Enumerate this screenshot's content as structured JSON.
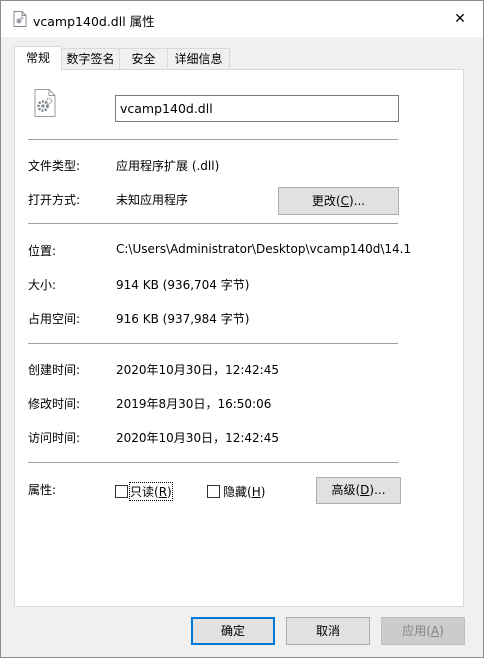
{
  "window": {
    "title": "vcamp140d.dll 属性",
    "close_glyph": "✕"
  },
  "tabs": [
    {
      "label": "常规",
      "active": true
    },
    {
      "label": "数字签名",
      "active": false
    },
    {
      "label": "安全",
      "active": false
    },
    {
      "label": "详细信息",
      "active": false
    }
  ],
  "general": {
    "file_name": "vcamp140d.dll",
    "file_icon": "dll-gear-file-icon",
    "type_label": "文件类型:",
    "type_value": "应用程序扩展 (.dll)",
    "opens_with_label": "打开方式:",
    "opens_with_value": "未知应用程序",
    "change_button": {
      "pre": "更改(",
      "key": "C",
      "post": ")..."
    },
    "location_label": "位置:",
    "location_value": "C:\\Users\\Administrator\\Desktop\\vcamp140d\\14.1",
    "size_label": "大小:",
    "size_value": "914 KB (936,704 字节)",
    "size_on_disk_label": "占用空间:",
    "size_on_disk_value": "916 KB (937,984 字节)",
    "created_label": "创建时间:",
    "created_value": "2020年10月30日，12:42:45",
    "modified_label": "修改时间:",
    "modified_value": "2019年8月30日，16:50:06",
    "accessed_label": "访问时间:",
    "accessed_value": "2020年10月30日，12:42:45",
    "attributes_label": "属性:",
    "readonly": {
      "pre": "只读(",
      "key": "R",
      "post": ")",
      "checked": false
    },
    "hidden": {
      "pre": "隐藏(",
      "key": "H",
      "post": ")",
      "checked": false
    },
    "advanced_button": {
      "pre": "高级(",
      "key": "D",
      "post": ")..."
    }
  },
  "footer": {
    "ok_label": "确定",
    "cancel_label": "取消",
    "apply": {
      "pre": "应用(",
      "key": "A",
      "post": ")"
    }
  },
  "colors": {
    "accent": "#0078d7",
    "separator": "#a0a0a0",
    "dialog_bg": "#f0f0f0"
  }
}
